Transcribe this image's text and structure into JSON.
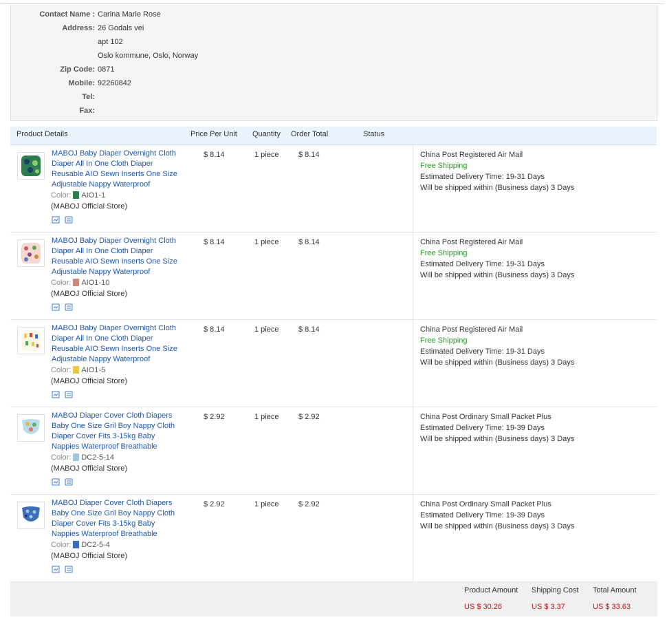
{
  "contact": {
    "name_label": "Contact Name :",
    "name": "Carina Marie Rose",
    "address_label": "Address:",
    "address_line1": "26 Godals vei",
    "address_line2": "apt 102",
    "address_line3": "Oslo kommune, Oslo, Norway",
    "zip_label": "Zip Code:",
    "zip": "0871",
    "mobile_label": "Mobile:",
    "mobile": "92260842",
    "tel_label": "Tel:",
    "tel": "",
    "fax_label": "Fax:",
    "fax": ""
  },
  "table_headers": {
    "product_details": "Product Details",
    "price_per_unit": "Price Per Unit",
    "quantity": "Quantity",
    "order_total": "Order Total",
    "status": "Status"
  },
  "products": [
    {
      "title": "MABOJ Baby Diaper Overnight Cloth Diaper All In One Cloth Diaper Reusable AIO Sewn Inserts One Size Adjustable Nappy Waterproof",
      "color_label": "Color:",
      "color_value": "AIO1-1",
      "swatch": "#2e7d4f",
      "store": "(MABOJ Official Store)",
      "price": "$ 8.14",
      "quantity": "1 piece",
      "order_total": "$ 8.14",
      "shipping_method": "China Post Registered Air Mail",
      "free_shipping": "Free Shipping",
      "delivery_time": "Estimated Delivery Time:  19-31 Days",
      "ship_within": "Will be shipped within (Business days) 3 Days"
    },
    {
      "title": "MABOJ Baby Diaper Overnight Cloth Diaper All In One Cloth Diaper Reusable AIO Sewn Inserts One Size Adjustable Nappy Waterproof",
      "color_label": "Color:",
      "color_value": "AIO1-10",
      "swatch": "#c98a7a",
      "store": "(MABOJ Official Store)",
      "price": "$ 8.14",
      "quantity": "1 piece",
      "order_total": "$ 8.14",
      "shipping_method": "China Post Registered Air Mail",
      "free_shipping": "Free Shipping",
      "delivery_time": "Estimated Delivery Time:  19-31 Days",
      "ship_within": "Will be shipped within (Business days) 3 Days"
    },
    {
      "title": "MABOJ Baby Diaper Overnight Cloth Diaper All In One Cloth Diaper Reusable AIO Sewn Inserts One Size Adjustable Nappy Waterproof",
      "color_label": "Color:",
      "color_value": "AIO1-5",
      "swatch": "#e6c84a",
      "store": "(MABOJ Official Store)",
      "price": "$ 8.14",
      "quantity": "1 piece",
      "order_total": "$ 8.14",
      "shipping_method": "China Post Registered Air Mail",
      "free_shipping": "Free Shipping",
      "delivery_time": "Estimated Delivery Time:  19-31 Days",
      "ship_within": "Will be shipped within (Business days) 3 Days"
    },
    {
      "title": "MABOJ Diaper Cover Cloth Diapers Baby One Size Gril Boy Nappy Cloth Diaper Cover Fits 3-15kg Baby Nappies Waterproof Breathable",
      "color_label": "Color:",
      "color_value": "DC2-5-14",
      "swatch": "#9fc7e0",
      "store": "(MABOJ Official Store)",
      "price": "$ 2.92",
      "quantity": "1 piece",
      "order_total": "$ 2.92",
      "shipping_method": "China Post Ordinary Small Packet Plus",
      "free_shipping": "",
      "delivery_time": "Estimated Delivery Time:  19-39 Days",
      "ship_within": "Will be shipped within (Business days) 3 Days"
    },
    {
      "title": "MABOJ Diaper Cover Cloth Diapers Baby One Size Gril Boy Nappy Cloth Diaper Cover Fits 3-15kg Baby Nappies Waterproof Breathable",
      "color_label": "Color:",
      "color_value": "DC2-5-4",
      "swatch": "#3d6fb8",
      "store": "(MABOJ Official Store)",
      "price": "$ 2.92",
      "quantity": "1 piece",
      "order_total": "$ 2.92",
      "shipping_method": "China Post Ordinary Small Packet Plus",
      "free_shipping": "",
      "delivery_time": "Estimated Delivery Time:  19-39 Days",
      "ship_within": "Will be shipped within (Business days) 3 Days"
    }
  ],
  "summary": {
    "product_amount_label": "Product Amount",
    "product_amount": "US $ 30.26",
    "shipping_cost_label": "Shipping Cost",
    "shipping_cost": "US $ 3.37",
    "total_amount_label": "Total Amount",
    "total_amount": "US $ 33.63"
  },
  "colors": {
    "link": "#1f57a6",
    "free_shipping": "#2b9a2b",
    "amount": "#c0161c",
    "header_bg": "#eaf3fc"
  },
  "icons": [
    "snapshot-icon",
    "message-icon"
  ]
}
